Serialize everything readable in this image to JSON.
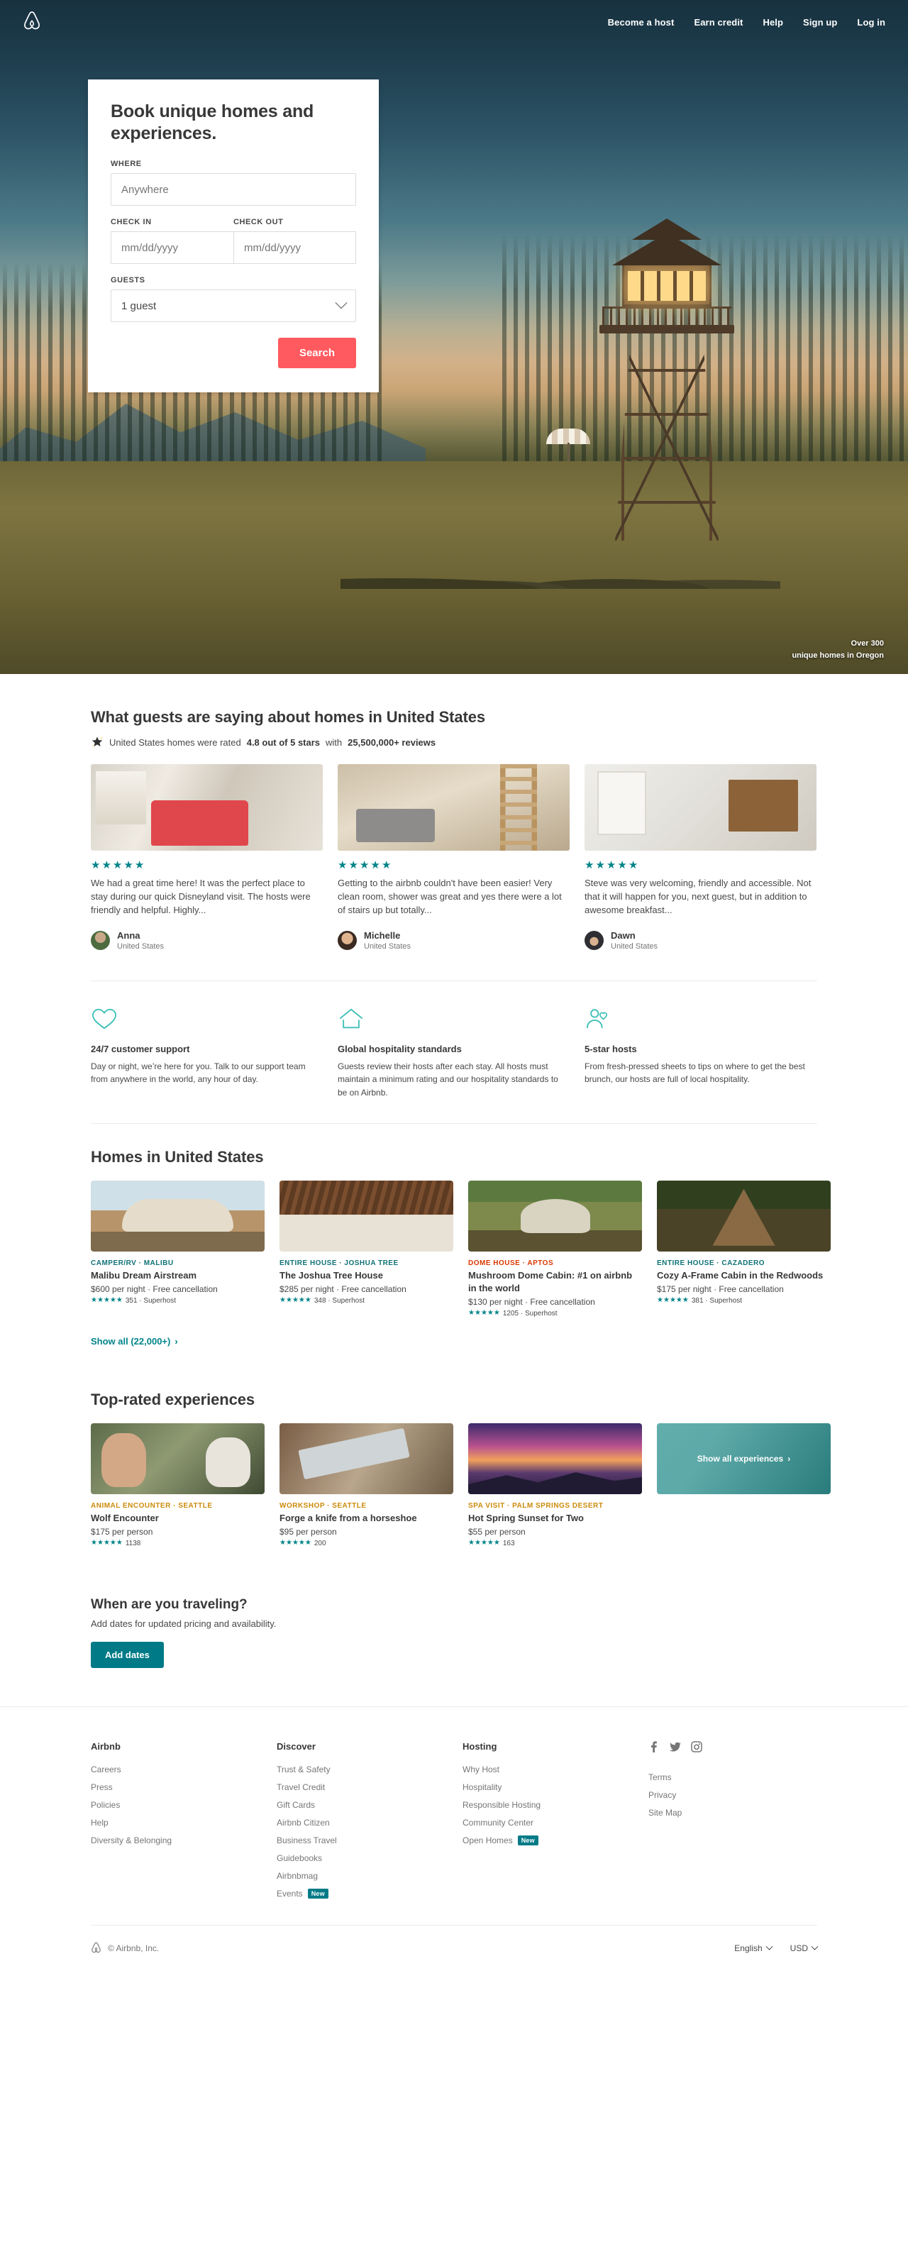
{
  "nav": {
    "logo": "airbnb-logo",
    "links": [
      {
        "label": "Become a host",
        "name": "become-a-host"
      },
      {
        "label": "Earn credit",
        "name": "earn-credit"
      },
      {
        "label": "Help",
        "name": "help"
      },
      {
        "label": "Sign up",
        "name": "sign-up"
      },
      {
        "label": "Log in",
        "name": "log-in"
      }
    ]
  },
  "hero": {
    "caption_line1": "Over 300",
    "caption_line2": "unique homes in Oregon"
  },
  "search": {
    "title": "Book unique homes and experiences.",
    "where_label": "WHERE",
    "where_placeholder": "Anywhere",
    "where_value": "",
    "checkin_label": "CHECK IN",
    "checkin_placeholder": "mm/dd/yyyy",
    "checkout_label": "CHECK OUT",
    "checkout_placeholder": "mm/dd/yyyy",
    "guests_label": "GUESTS",
    "guests_value": "1 guest",
    "search_button": "Search"
  },
  "reviews": {
    "heading": "What guests are saying about homes in United States",
    "rating_prefix": "United States homes were rated",
    "rating_value": "4.8 out of 5 stars",
    "rating_mid": "with",
    "rating_count": "25,500,000+ reviews",
    "cards": [
      {
        "stars": 5,
        "text": "We had a great time here! It was the perfect place to stay during our quick Disneyland visit. The hosts were friendly and helpful. Highly...",
        "name": "Anna",
        "location": "United States"
      },
      {
        "stars": 5,
        "text": "Getting to the airbnb couldn't have been easier! Very clean room, shower was great and yes there were a lot of stairs up but totally...",
        "name": "Michelle",
        "location": "United States"
      },
      {
        "stars": 5,
        "text": "Steve was very welcoming, friendly and accessible. Not that it will happen for you, next guest, but in addition to awesome breakfast...",
        "name": "Dawn",
        "location": "United States"
      }
    ]
  },
  "features": [
    {
      "icon": "heart-icon",
      "title": "24/7 customer support",
      "body": "Day or night, we’re here for you. Talk to our support team from anywhere in the world, any hour of day."
    },
    {
      "icon": "house-icon",
      "title": "Global hospitality standards",
      "body": "Guests review their hosts after each stay. All hosts must maintain a minimum rating and our hospitality standards to be on Airbnb."
    },
    {
      "icon": "hosts-icon",
      "title": "5-star hosts",
      "body": "From fresh-pressed sheets to tips on where to get the best brunch, our hosts are full of local hospitality."
    }
  ],
  "homes": {
    "heading": "Homes in United States",
    "show_all": "Show all (22,000+)",
    "cards": [
      {
        "category": "CAMPER/RV · MALIBU",
        "category_color": "teal",
        "name": "Malibu Dream Airstream",
        "price": "$600",
        "price_rest": "per night · Free cancellation",
        "stars": 5,
        "reviews": "351 · Superhost"
      },
      {
        "category": "ENTIRE HOUSE · JOSHUA TREE",
        "category_color": "teal",
        "name": "The Joshua Tree House",
        "price": "$285",
        "price_rest": "per night · Free cancellation",
        "stars": 5,
        "reviews": "348 · Superhost"
      },
      {
        "category": "DOME HOUSE · APTOS",
        "category_color": "red",
        "name": "Mushroom Dome Cabin: #1 on airbnb in the world",
        "price": "$130",
        "price_rest": "per night · Free cancellation",
        "stars": 5,
        "reviews": "1205 · Superhost"
      },
      {
        "category": "ENTIRE HOUSE · CAZADERO",
        "category_color": "teal",
        "name": "Cozy A-Frame Cabin in the Redwoods",
        "price": "$175",
        "price_rest": "per night · Free cancellation",
        "stars": 5,
        "reviews": "381 · Superhost"
      }
    ]
  },
  "experiences": {
    "heading": "Top-rated experiences",
    "show_all": "Show all experiences",
    "cards": [
      {
        "category": "ANIMAL ENCOUNTER · SEATTLE",
        "name": "Wolf Encounter",
        "price": "$175 per person",
        "stars": 5,
        "reviews": "1138"
      },
      {
        "category": "WORKSHOP · SEATTLE",
        "name": "Forge a knife from a horseshoe",
        "price": "$95 per person",
        "stars": 5,
        "reviews": "200"
      },
      {
        "category": "SPA VISIT · PALM SPRINGS DESERT",
        "name": "Hot Spring Sunset for Two",
        "price": "$55 per person",
        "stars": 5,
        "reviews": "163"
      }
    ]
  },
  "travel": {
    "title": "When are you traveling?",
    "subtitle": "Add dates for updated pricing and availability.",
    "button": "Add dates"
  },
  "footer": {
    "columns": [
      {
        "title": "Airbnb",
        "links": [
          {
            "label": "Careers"
          },
          {
            "label": "Press"
          },
          {
            "label": "Policies"
          },
          {
            "label": "Help"
          },
          {
            "label": "Diversity & Belonging"
          }
        ]
      },
      {
        "title": "Discover",
        "links": [
          {
            "label": "Trust & Safety"
          },
          {
            "label": "Travel Credit"
          },
          {
            "label": "Gift Cards"
          },
          {
            "label": "Airbnb Citizen"
          },
          {
            "label": "Business Travel"
          },
          {
            "label": "Guidebooks"
          },
          {
            "label": "Airbnbmag"
          },
          {
            "label": "Events",
            "badge": "New"
          }
        ]
      },
      {
        "title": "Hosting",
        "links": [
          {
            "label": "Why Host"
          },
          {
            "label": "Hospitality"
          },
          {
            "label": "Responsible Hosting"
          },
          {
            "label": "Community Center"
          },
          {
            "label": "Open Homes",
            "badge": "New"
          }
        ]
      }
    ],
    "social": [
      "facebook-icon",
      "twitter-icon",
      "instagram-icon"
    ],
    "legal": [
      {
        "label": "Terms"
      },
      {
        "label": "Privacy"
      },
      {
        "label": "Site Map"
      }
    ],
    "copyright": "© Airbnb, Inc.",
    "language": "English",
    "currency": "USD"
  },
  "colors": {
    "brand_red": "#ff5a5f",
    "teal": "#008489",
    "dark_teal": "#007a87",
    "text": "#484848",
    "heading": "#383838",
    "muted": "#767676",
    "category_red": "#d93900",
    "category_amber": "#cc8b0a"
  }
}
